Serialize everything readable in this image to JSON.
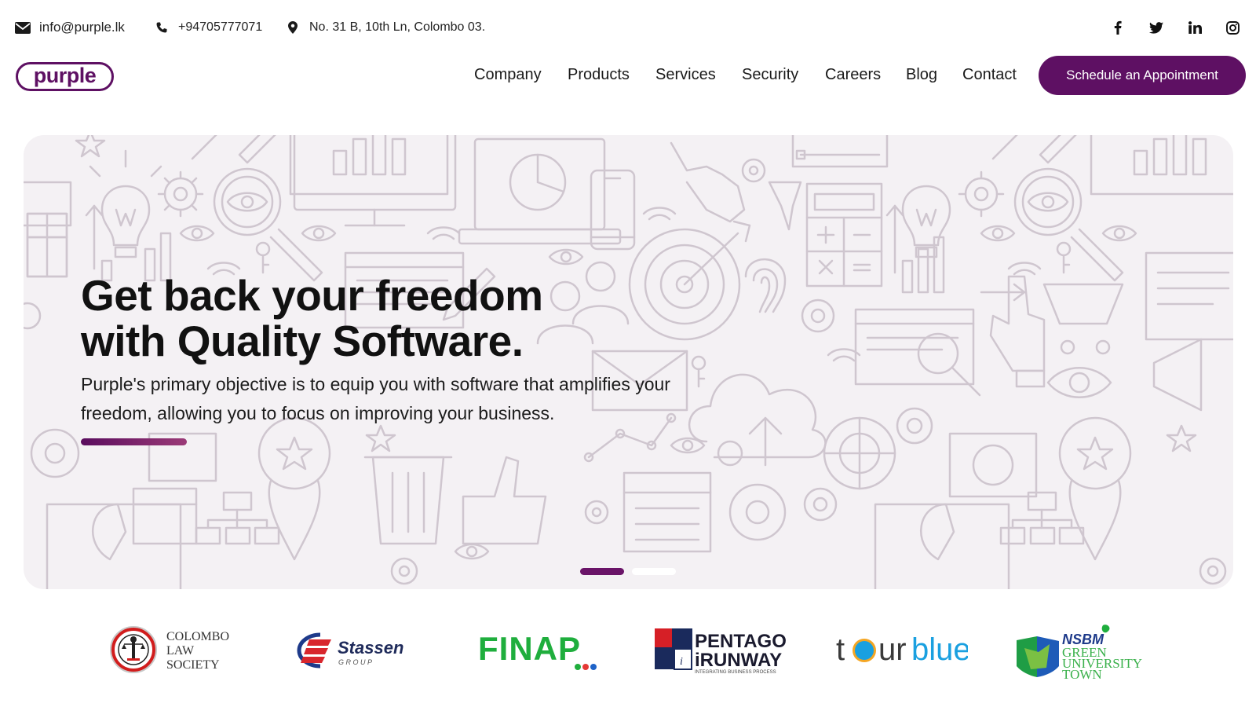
{
  "topbar": {
    "email": "info@purple.lk",
    "phone": "+94705777071",
    "address": "No. 31 B, 10th Ln, Colombo 03.",
    "email_icon": "envelope-icon",
    "phone_icon": "phone-icon",
    "address_icon": "map-pin-icon",
    "social": [
      {
        "name": "facebook-icon",
        "glyph": "f"
      },
      {
        "name": "twitter-icon",
        "glyph": "t"
      },
      {
        "name": "linkedin-icon",
        "glyph": "in"
      },
      {
        "name": "instagram-icon",
        "glyph": "ig"
      }
    ]
  },
  "header": {
    "logo_text": "purple",
    "nav": [
      "Company",
      "Products",
      "Services",
      "Security",
      "Careers",
      "Blog",
      "Contact"
    ],
    "cta_label": "Schedule an Appointment"
  },
  "hero": {
    "title_line1": "Get back your freedom",
    "title_line2": "with Quality Software.",
    "subtitle": "Purple's primary objective is to equip you with software that amplifies your freedom, allowing you to focus on improving your business.",
    "slides_total": 2,
    "active_slide": 1
  },
  "clients": {
    "colombo": [
      "COLOMBO",
      "LAW",
      "SOCIETY"
    ],
    "stassen": "Stassen",
    "stassen_sub": "G R O U P",
    "finap": "FINAP",
    "pentagon": [
      "PENTAGON",
      "iRUNWAY"
    ],
    "pentagon_tag": "INTEGRATING BUSINESS PROCESS",
    "tourblue_1": "t",
    "tourblue_2": "ur",
    "tourblue_3": "blue",
    "nsbm_1": "NSBM",
    "nsbm_2": [
      "GREEN",
      "UNIVERSITY",
      "TOWN"
    ]
  },
  "colors": {
    "brand": "#5e1063",
    "hero_bg": "#f4f1f4"
  }
}
